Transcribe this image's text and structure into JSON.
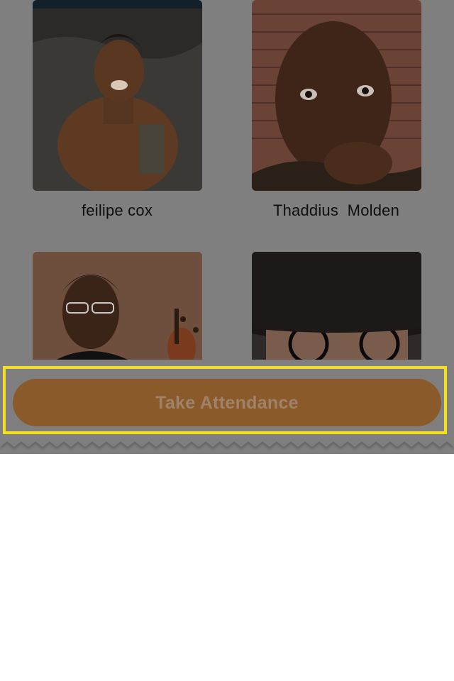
{
  "students": [
    {
      "name": "feilipe cox"
    },
    {
      "name": "Thaddius  Molden"
    },
    {
      "name": ""
    },
    {
      "name": ""
    }
  ],
  "actions": {
    "take_attendance_label": "Take Attendance"
  },
  "colors": {
    "overlay_gray": "#7f7f7f",
    "button_fill": "#8a5a2a",
    "button_text": "#a0826a",
    "highlight": "#f0e020"
  }
}
